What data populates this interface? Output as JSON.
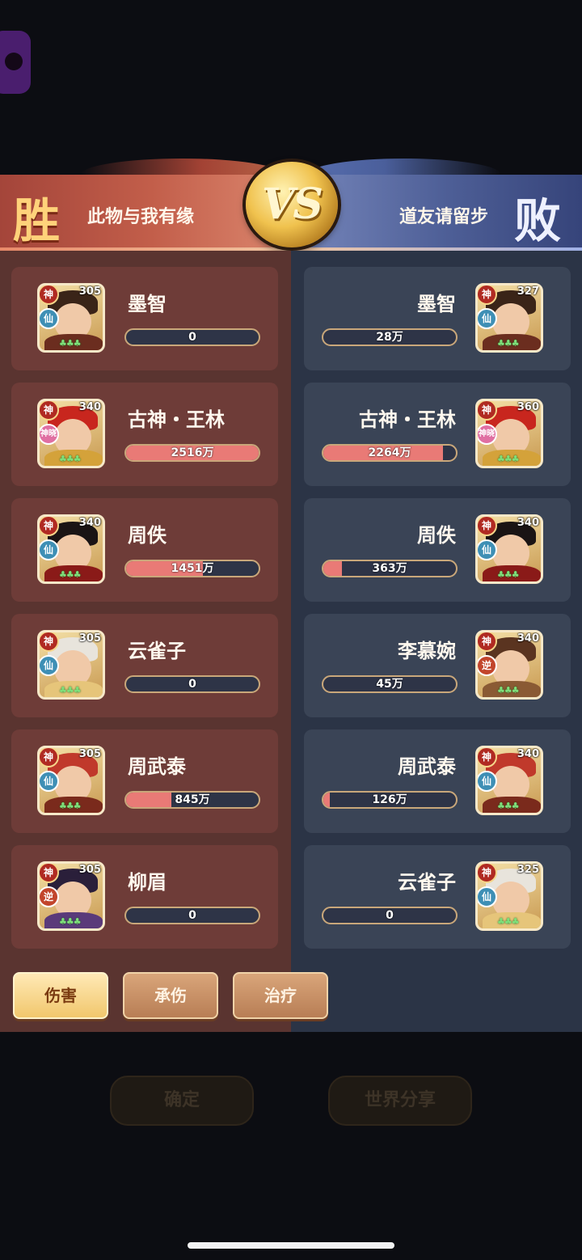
{
  "header": {
    "win_char": "胜",
    "lose_char": "败",
    "vs_text": "VS",
    "left_team": "此物与我有缘",
    "right_team": "道友请留步"
  },
  "left_heroes": [
    {
      "name": "墨智",
      "level": "305",
      "tier": "神",
      "sub": "仙",
      "value": "0",
      "fill": 0,
      "hair": "#3a2418",
      "body": "#6b2d1f"
    },
    {
      "name": "古神・王林",
      "level": "340",
      "tier": "神",
      "sub": "神晓",
      "value": "2516万",
      "fill": 1.0,
      "hair": "#c8261e",
      "body": "#d4a23a"
    },
    {
      "name": "周佚",
      "level": "340",
      "tier": "神",
      "sub": "仙",
      "value": "1451万",
      "fill": 0.58,
      "hair": "#1a1414",
      "body": "#8a1a18"
    },
    {
      "name": "云雀子",
      "level": "305",
      "tier": "神",
      "sub": "仙",
      "value": "0",
      "fill": 0,
      "hair": "#e8e4dc",
      "body": "#e6c57a"
    },
    {
      "name": "周武泰",
      "level": "305",
      "tier": "神",
      "sub": "仙",
      "value": "845万",
      "fill": 0.34,
      "hair": "#c0392b",
      "body": "#7a2a1c"
    },
    {
      "name": "柳眉",
      "level": "305",
      "tier": "神",
      "sub": "逆",
      "value": "0",
      "fill": 0,
      "hair": "#2a1f3a",
      "body": "#5a3a7a"
    }
  ],
  "right_heroes": [
    {
      "name": "墨智",
      "level": "327",
      "tier": "神",
      "sub": "仙",
      "value": "28万",
      "fill": 0,
      "hair": "#3a2418",
      "body": "#6b2d1f"
    },
    {
      "name": "古神・王林",
      "level": "360",
      "tier": "神",
      "sub": "神晓",
      "value": "2264万",
      "fill": 0.9,
      "hair": "#c8261e",
      "body": "#d4a23a"
    },
    {
      "name": "周佚",
      "level": "340",
      "tier": "神",
      "sub": "仙",
      "value": "363万",
      "fill": 0.14,
      "hair": "#1a1414",
      "body": "#8a1a18"
    },
    {
      "name": "李慕婉",
      "level": "340",
      "tier": "神",
      "sub": "逆",
      "value": "45万",
      "fill": 0,
      "hair": "#5a3420",
      "body": "#8a5a34"
    },
    {
      "name": "周武泰",
      "level": "340",
      "tier": "神",
      "sub": "仙",
      "value": "126万",
      "fill": 0.05,
      "hair": "#c0392b",
      "body": "#7a2a1c"
    },
    {
      "name": "云雀子",
      "level": "325",
      "tier": "神",
      "sub": "仙",
      "value": "0",
      "fill": 0,
      "hair": "#e8e4dc",
      "body": "#e6c57a"
    }
  ],
  "tabs": [
    {
      "label": "伤害",
      "active": true
    },
    {
      "label": "承伤",
      "active": false
    },
    {
      "label": "治疗",
      "active": false
    }
  ],
  "bottom_buttons": {
    "confirm": "确定",
    "share": "世界分享"
  },
  "colors": {
    "bar_fill": "#e97a76",
    "left_panel": "#5a3430",
    "right_panel": "#2b3446"
  }
}
